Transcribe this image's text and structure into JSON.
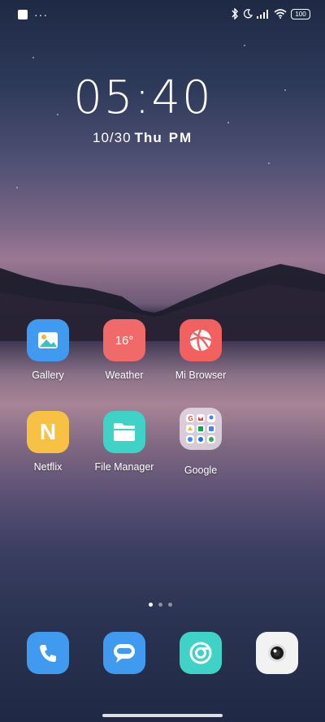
{
  "status_bar": {
    "left_dots": "···",
    "battery": "100",
    "icons": [
      "square-notification-icon",
      "bluetooth-icon",
      "moon-icon",
      "signal-icon",
      "wifi-icon",
      "battery-icon"
    ]
  },
  "clock": {
    "time": "05:40",
    "date": "10/30",
    "weekday": "Thu",
    "ampm": "PM"
  },
  "weather_temp": "16°",
  "netflix_letter": "N",
  "apps": [
    {
      "label": "Gallery",
      "icon": "gallery-icon",
      "color": "#3f9af0"
    },
    {
      "label": "Weather",
      "icon": "weather-icon",
      "color": "#f06a6a"
    },
    {
      "label": "Mi Browser",
      "icon": "browser-icon",
      "color": "#f26060"
    },
    {
      "label": "Netflix",
      "icon": "netflix-icon",
      "color": "#f7c244"
    },
    {
      "label": "File Manager",
      "icon": "folder-icon",
      "color": "#3fd2c6"
    },
    {
      "label": "Google",
      "icon": "google-folder-icon",
      "color": "#d9cdd9"
    }
  ],
  "dock": [
    {
      "icon": "phone-icon",
      "color": "#3f9af0"
    },
    {
      "icon": "messages-icon",
      "color": "#3f9af0"
    },
    {
      "icon": "chrome-icon",
      "color": "#3fd2c6"
    },
    {
      "icon": "camera-icon",
      "color": "#f2f2f2"
    }
  ],
  "pager": {
    "pages": 3,
    "current": 1
  }
}
